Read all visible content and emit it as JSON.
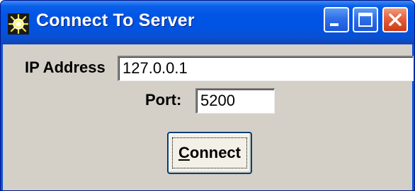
{
  "window": {
    "title": "Connect To Server",
    "app_icon": "sun-burst-icon",
    "controls": {
      "minimize_icon": "minimize-icon",
      "maximize_icon": "maximize-icon",
      "close_icon": "close-icon"
    }
  },
  "form": {
    "ip_label": "IP Address",
    "ip_value": "127.0.0.1",
    "port_label": "Port:",
    "port_value": "5200",
    "connect_button": {
      "mnemonic": "C",
      "rest": "onnect"
    }
  },
  "colors": {
    "titlebar": "#0054e3",
    "client_background": "#d4d0c8",
    "close_button": "#e5603c"
  }
}
